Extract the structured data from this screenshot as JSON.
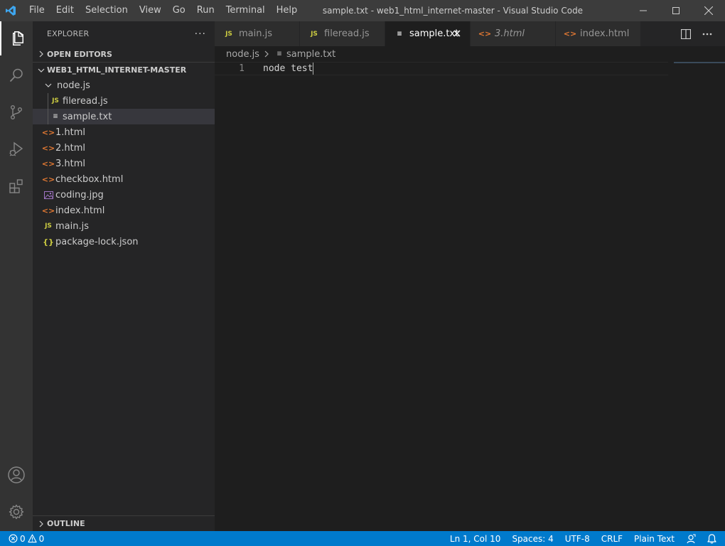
{
  "window": {
    "title": "sample.txt - web1_html_internet-master - Visual Studio Code",
    "menu": [
      "File",
      "Edit",
      "Selection",
      "View",
      "Go",
      "Run",
      "Terminal",
      "Help"
    ]
  },
  "activity_bar": {
    "items": [
      "explorer-icon",
      "search-icon",
      "source-control-icon",
      "run-debug-icon",
      "extensions-icon"
    ],
    "bottom": [
      "account-icon",
      "settings-gear-icon"
    ]
  },
  "sidebar": {
    "title": "EXPLORER",
    "more": "···",
    "open_editors": "OPEN EDITORS",
    "project": "WEB1_HTML_INTERNET-MASTER",
    "folder": "node.js",
    "folder_files": [
      {
        "name": "fileread.js",
        "icon": "JS"
      },
      {
        "name": "sample.txt",
        "icon": "≡"
      }
    ],
    "files": [
      {
        "name": "1.html",
        "icon": "<>"
      },
      {
        "name": "2.html",
        "icon": "<>"
      },
      {
        "name": "3.html",
        "icon": "<>"
      },
      {
        "name": "checkbox.html",
        "icon": "<>"
      },
      {
        "name": "coding.jpg",
        "icon": "img"
      },
      {
        "name": "index.html",
        "icon": "<>"
      },
      {
        "name": "main.js",
        "icon": "JS"
      },
      {
        "name": "package-lock.json",
        "icon": "{}"
      }
    ],
    "outline": "OUTLINE"
  },
  "tabs": [
    {
      "label": "main.js",
      "icon": "JS"
    },
    {
      "label": "fileread.js",
      "icon": "JS"
    },
    {
      "label": "sample.txt",
      "icon": "≡",
      "active": true
    },
    {
      "label": "3.html",
      "icon": "<>",
      "preview": true
    },
    {
      "label": "index.html",
      "icon": "<>"
    }
  ],
  "breadcrumb": {
    "folder": "node.js",
    "file": "sample.txt"
  },
  "editor": {
    "line_number": "1",
    "content": "node test"
  },
  "statusbar": {
    "errors": "0",
    "warnings": "0",
    "position": "Ln 1, Col 10",
    "spaces": "Spaces: 4",
    "encoding": "UTF-8",
    "eol": "CRLF",
    "language": "Plain Text"
  },
  "colors": {
    "accent": "#007acc",
    "titlebar": "#3c3c3c",
    "activitybar": "#333333",
    "sidebar": "#252526",
    "editor": "#1e1e1e"
  }
}
